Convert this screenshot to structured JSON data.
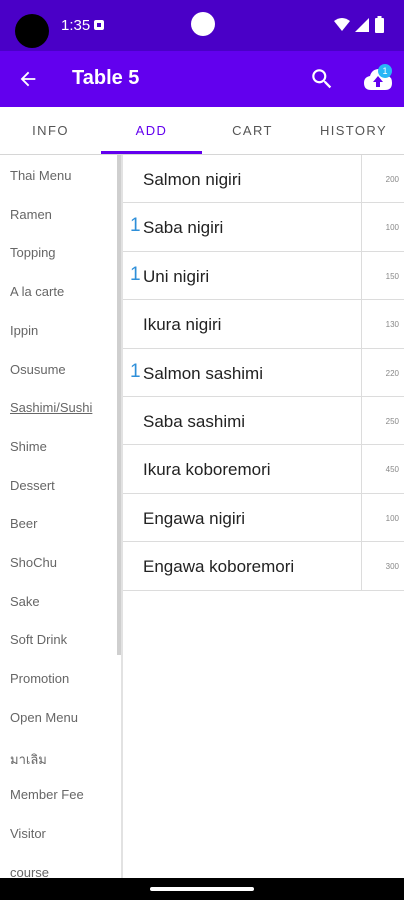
{
  "status_bar": {
    "time": "1:35"
  },
  "app_bar": {
    "title": "Table 5",
    "cart_badge": "1"
  },
  "tabs": [
    {
      "label": "INFO"
    },
    {
      "label": "ADD"
    },
    {
      "label": "CART"
    },
    {
      "label": "HISTORY"
    }
  ],
  "active_tab": "ADD",
  "sidebar": {
    "selected": "Sashimi/Sushi",
    "items": [
      "Thai Menu",
      "Ramen",
      "Topping",
      "A la carte",
      "Ippin",
      "Osusume",
      "Sashimi/Sushi",
      "Shime",
      "Dessert",
      "Beer",
      "ShoChu",
      "Sake",
      "Soft Drink",
      "Promotion",
      "Open Menu",
      "มาเลิม",
      "Member Fee",
      "Visitor",
      "course"
    ]
  },
  "menu": {
    "items": [
      {
        "count": "",
        "name": "Salmon nigiri",
        "price": "200"
      },
      {
        "count": "1",
        "name": "Saba nigiri",
        "price": "100"
      },
      {
        "count": "1",
        "name": "Uni nigiri",
        "price": "150"
      },
      {
        "count": "",
        "name": "Ikura nigiri",
        "price": "130"
      },
      {
        "count": "1",
        "name": "Salmon sashimi",
        "price": "220"
      },
      {
        "count": "",
        "name": "Saba sashimi",
        "price": "250"
      },
      {
        "count": "",
        "name": "Ikura koboremori",
        "price": "450"
      },
      {
        "count": "",
        "name": "Engawa nigiri",
        "price": "100"
      },
      {
        "count": "",
        "name": "Engawa koboremori",
        "price": "300"
      }
    ]
  },
  "colors": {
    "status_bar": "#4a00c7",
    "app_bar": "#6200ee",
    "accent": "#6200ee",
    "count_blue": "#2e8fd9",
    "badge": "#29b6f6"
  },
  "icons": {
    "back": "arrow-back-icon",
    "search": "search-icon",
    "cloud": "cloud-upload-icon"
  }
}
